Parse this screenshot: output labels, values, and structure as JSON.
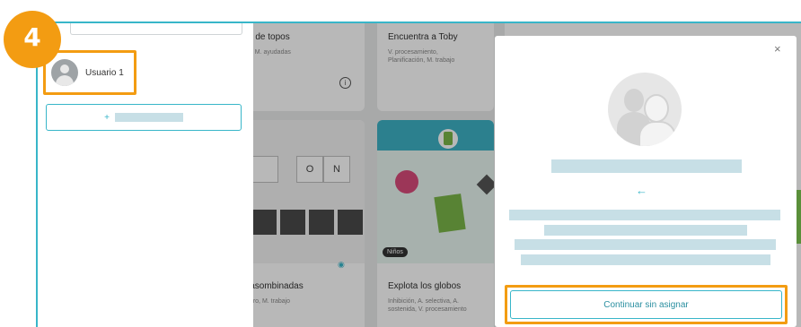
{
  "step_badge": "4",
  "left_panel": {
    "user": {
      "name": "Usuario 1"
    },
    "add_button": {
      "plus": "+"
    }
  },
  "background": {
    "cards": [
      {
        "title": "n de topos",
        "subtitle": "ñ, M. ayudadas"
      },
      {
        "title": "Encuentra a Toby",
        "subtitle": "V. procesamiento,\nPlanificación, M. trabajo"
      },
      {
        "title": "lasombinadas",
        "subtitle": "ntro, M. trabajo"
      },
      {
        "title": "Explota los globos",
        "subtitle": "Inhibición, A. selectiva, A.\nsostenida, V. procesamiento"
      }
    ],
    "tiles": [
      "O",
      "N"
    ],
    "badge": "Niños"
  },
  "modal": {
    "close_label": "×",
    "arrow": "←",
    "continue_label": "Continuar sin asignar"
  },
  "colors": {
    "accent": "#38b6c9",
    "highlight": "#f39c12",
    "redacted": "#c7dfe6"
  }
}
